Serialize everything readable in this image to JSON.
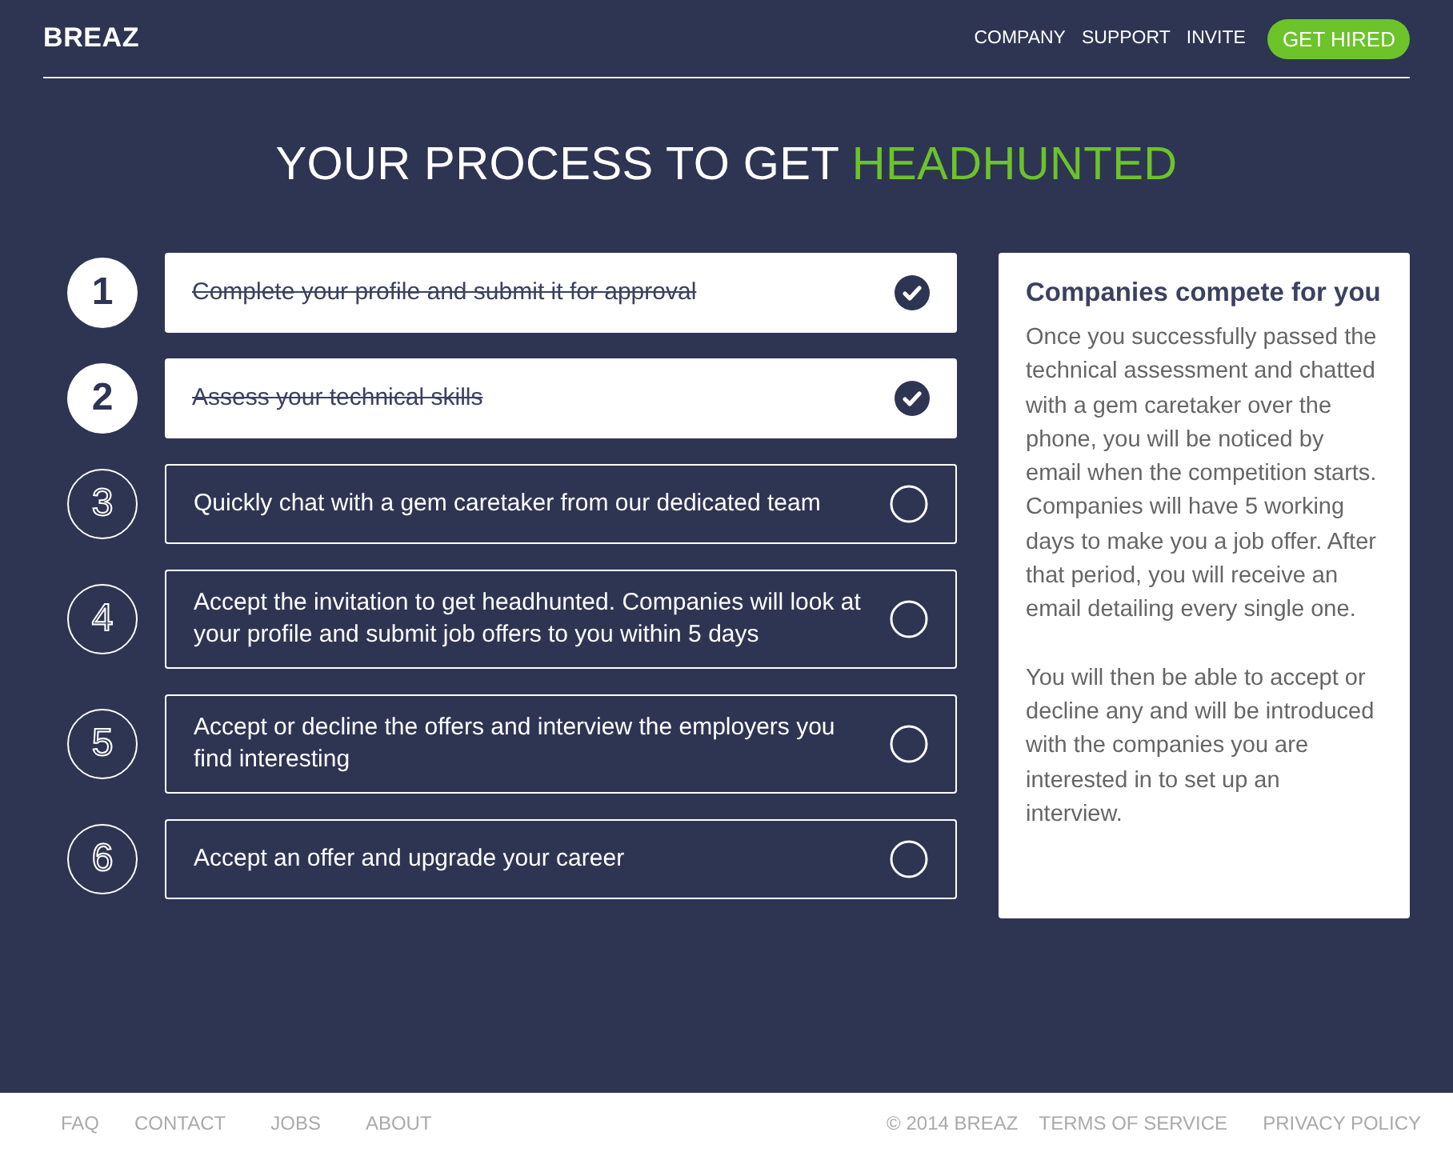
{
  "header": {
    "logo": "BREAZ",
    "nav": [
      "COMPANY",
      "SUPPORT",
      "INVITE"
    ],
    "cta": "GET HIRED"
  },
  "title": {
    "text": "YOUR PROCESS TO GET ",
    "highlight": "HEADHUNTED"
  },
  "steps": [
    {
      "number": "1",
      "text": "Complete your profile and submit it for approval",
      "done": true
    },
    {
      "number": "2",
      "text": "Assess your technical skills",
      "done": true
    },
    {
      "number": "3",
      "text": "Quickly chat with a gem caretaker from our dedicated team",
      "done": false
    },
    {
      "number": "4",
      "text": "Accept the invitation to get headhunted. Companies will look at your profile and submit job offers to you within 5 days",
      "done": false
    },
    {
      "number": "5",
      "text": "Accept or decline the offers and interview the employers you find interesting",
      "done": false
    },
    {
      "number": "6",
      "text": "Accept an offer and upgrade your career",
      "done": false
    }
  ],
  "panel": {
    "heading": "Companies compete for you",
    "paragraphs": [
      "Once you successfully passed the technical assessment and chatted with a gem caretaker over the phone, you will be noticed by email when the competition starts. Companies will have 5 working days to make you a job offer. After that period, you will receive an email detailing every single one.",
      "You will then be able to accept or decline any and will be introduced with the companies you are interested in to set up an interview."
    ]
  },
  "footer": {
    "left": [
      "FAQ",
      "CONTACT",
      "JOBS",
      "ABOUT"
    ],
    "copyright": "© 2014 BREAZ",
    "right": [
      "TERMS OF SERVICE",
      "PRIVACY POLICY"
    ]
  }
}
